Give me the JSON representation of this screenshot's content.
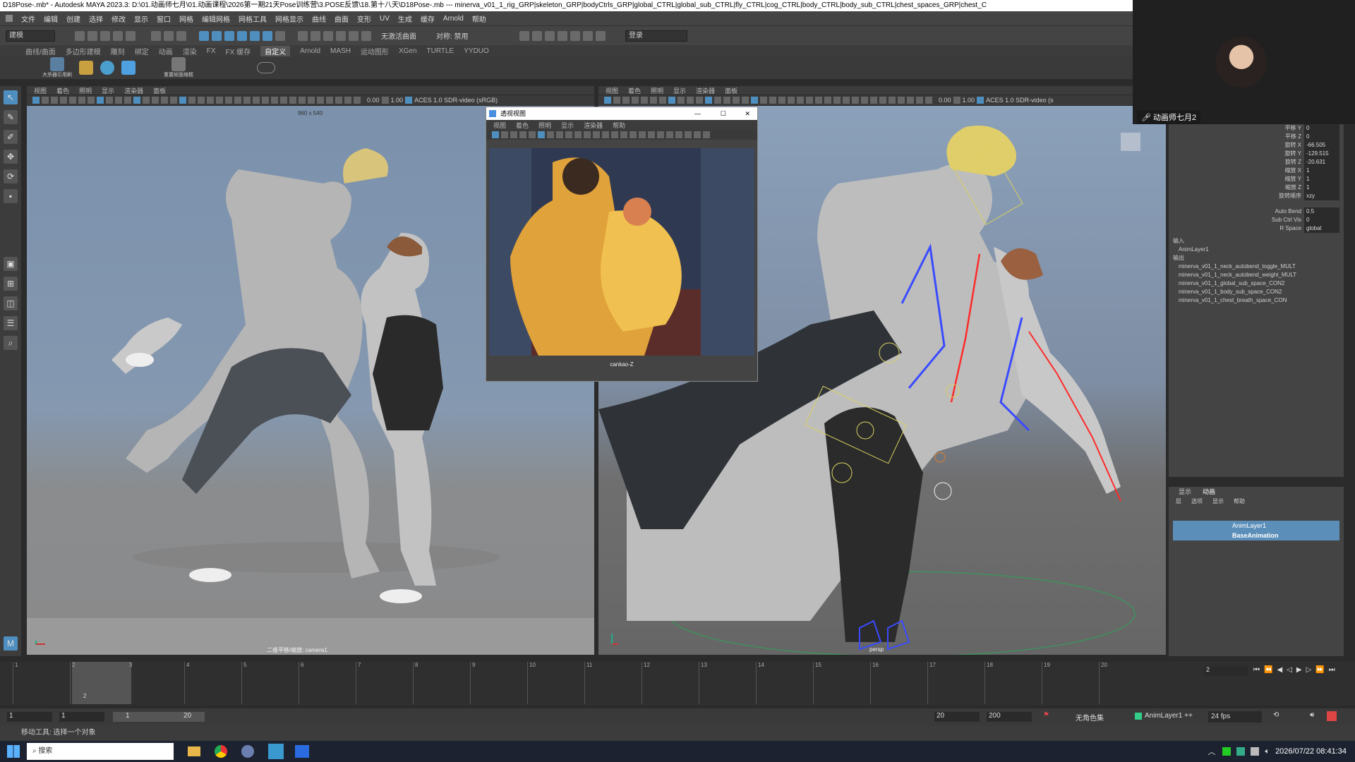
{
  "title": "D18Pose-.mb* - Autodesk MAYA 2023.3: D:\\01.动画师七月\\01.动画课程\\2026第一期21天Pose训练营\\3.POSE反馈\\18.第十八天\\D18Pose-.mb   ---   minerva_v01_1_rig_GRP|skeleton_GRP|bodyCtrls_GRP|global_CTRL|global_sub_CTRL|fly_CTRL|cog_CTRL|body_CTRL|body_sub_CTRL|chest_spaces_GRP|chest_C",
  "menu": [
    "文件",
    "编辑",
    "创建",
    "选择",
    "修改",
    "显示",
    "窗口",
    "网格",
    "编辑网格",
    "网格工具",
    "网格显示",
    "曲线",
    "曲面",
    "变形",
    "UV",
    "生成",
    "缓存",
    "Arnold",
    "帮助"
  ],
  "toolbar": {
    "mode": "建模",
    "no_live_surface": "无激活曲面",
    "symmetry": "对称: 禁用",
    "login": "登录"
  },
  "shelf_tabs": [
    "曲线/曲面",
    "多边形建模",
    "雕刻",
    "绑定",
    "动画",
    "渲染",
    "FX",
    "FX 缓存",
    "自定义",
    "Arnold",
    "MASH",
    "运动图形",
    "XGen",
    "TURTLE",
    "YYDUO"
  ],
  "shelf_active": "自定义",
  "shelf_labels": {
    "a": "大杀器引用刷",
    "b": "重置帧面缩框"
  },
  "panel_menu": [
    "视图",
    "着色",
    "照明",
    "显示",
    "渲染器",
    "面板"
  ],
  "panel_tool": {
    "val1": "0.00",
    "val2": "1.00",
    "colorspace": "ACES 1.0 SDR-video (sRGB)",
    "colorspace_short": "ACES 1.0 SDR-video (s"
  },
  "left_viewport": {
    "resolution": "960 x 540",
    "camera": "二维平移/缩放: camera1"
  },
  "right_viewport": {
    "camera": "persp"
  },
  "float_window": {
    "title": "透视视图",
    "menu": [
      "视图",
      "着色",
      "照明",
      "显示",
      "渲染器",
      "帮助"
    ],
    "camera": "cankao-Z"
  },
  "webcam": {
    "name": "动画师七月2"
  },
  "channelbox": {
    "rows": [
      {
        "k": "平移 Y",
        "v": "0"
      },
      {
        "k": "平移 Z",
        "v": "0"
      },
      {
        "k": "旋转 X",
        "v": "-66.505"
      },
      {
        "k": "旋转 Y",
        "v": "-129.515"
      },
      {
        "k": "旋转 Z",
        "v": "-20.631"
      },
      {
        "k": "缩放 X",
        "v": "1"
      },
      {
        "k": "缩放 Y",
        "v": "1"
      },
      {
        "k": "缩放 Z",
        "v": "1"
      },
      {
        "k": "旋转顺序",
        "v": "xzy"
      }
    ],
    "extra": [
      {
        "k": "Auto Bend",
        "v": "0.5"
      },
      {
        "k": "Sub Ctrl Vis",
        "v": "0"
      },
      {
        "k": "R Space",
        "v": "global"
      }
    ],
    "inputs_label": "输入",
    "inputs": [
      "AnimLayer1"
    ],
    "outputs_label": "输出",
    "outputs": [
      "minerva_v01_1_neck_autobend_toggle_MULT",
      "minerva_v01_1_neck_autobend_weight_MULT",
      "minerva_v01_1_global_sub_space_CON2",
      "minerva_v01_1_body_sub_space_CON2",
      "minerva_v01_1_chest_breath_space_CON"
    ]
  },
  "layers": {
    "tabs": [
      "显示",
      "动画"
    ],
    "menu": [
      "层",
      "选项",
      "显示",
      "帮助"
    ],
    "items": [
      "AnimLayer1",
      "BaseAnimation"
    ]
  },
  "timeline": {
    "ticks": [
      "1",
      "2",
      "3",
      "4",
      "5",
      "6",
      "7",
      "8",
      "9",
      "10",
      "11",
      "12",
      "13",
      "14",
      "15",
      "16",
      "17",
      "18",
      "19",
      "20"
    ],
    "current": "2",
    "current_field": "2"
  },
  "range": {
    "start": "1",
    "start2": "1",
    "slider_a": "1",
    "slider_b": "20",
    "end": "20",
    "end2": "200",
    "no_char_set": "无角色集",
    "anim_layer": "AnimLayer1 ++",
    "fps": "24 fps"
  },
  "status": "移动工具: 选择一个对象",
  "taskbar": {
    "search": "搜索",
    "clock": "2026/07/22 08:41:34"
  }
}
